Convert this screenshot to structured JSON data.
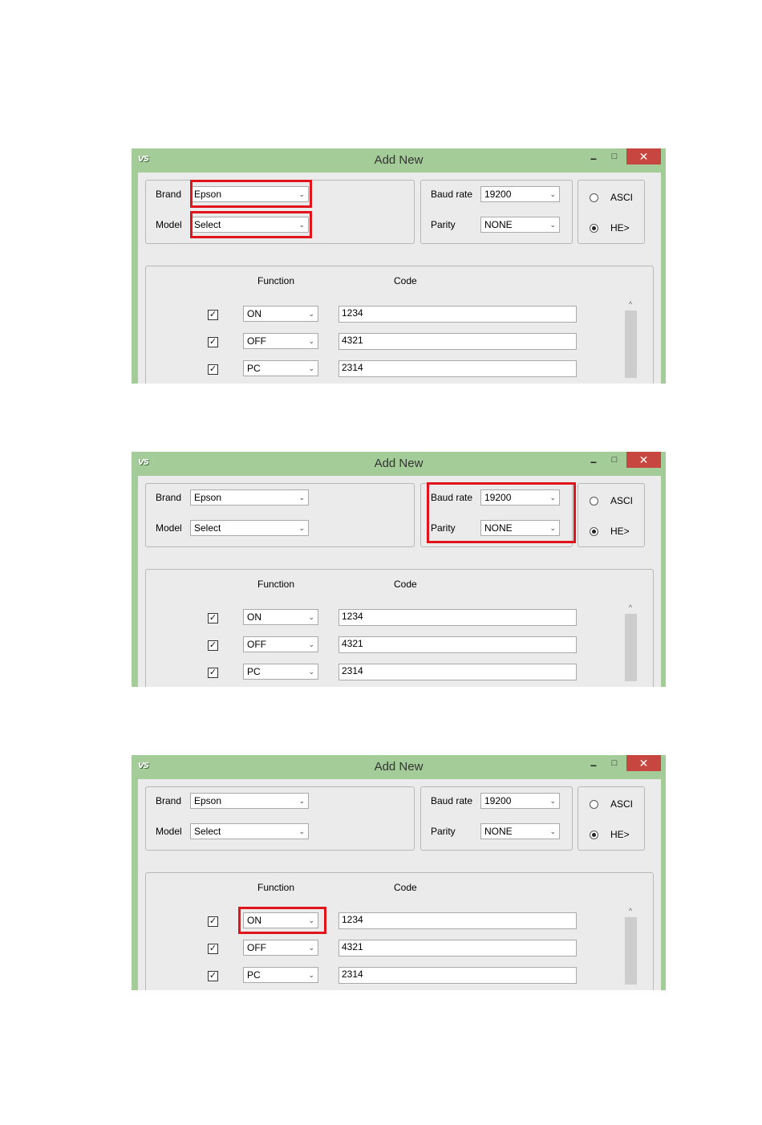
{
  "window": {
    "title": "Add New",
    "icon_text": "VS",
    "minimize": "−",
    "maximize": "□",
    "close": "✕"
  },
  "brand": {
    "label": "Brand",
    "value": "Epson"
  },
  "model": {
    "label": "Model",
    "value": "Select"
  },
  "baud_rate": {
    "label": "Baud rate",
    "value": "19200"
  },
  "parity": {
    "label": "Parity",
    "value": "NONE"
  },
  "mode": {
    "ascii_label": "ASCI",
    "hex_label": "HE>",
    "selected": "HEX"
  },
  "functions": {
    "function_header": "Function",
    "code_header": "Code",
    "rows": [
      {
        "checked": true,
        "function": "ON",
        "code": "1234"
      },
      {
        "checked": true,
        "function": "OFF",
        "code": "4321"
      },
      {
        "checked": true,
        "function": "PC",
        "code": "2314"
      }
    ]
  },
  "dropdown_arrow": "⌄",
  "check_mark": "✓",
  "scroll_up": "^",
  "colors": {
    "titlebar": "#a4cc98",
    "client": "#ebebeb",
    "close_button": "#c7463f",
    "highlight": "#e0141a"
  },
  "screenshots": [
    {
      "highlight": "brand-model"
    },
    {
      "highlight": "baud-parity"
    },
    {
      "highlight": "function-on"
    }
  ]
}
